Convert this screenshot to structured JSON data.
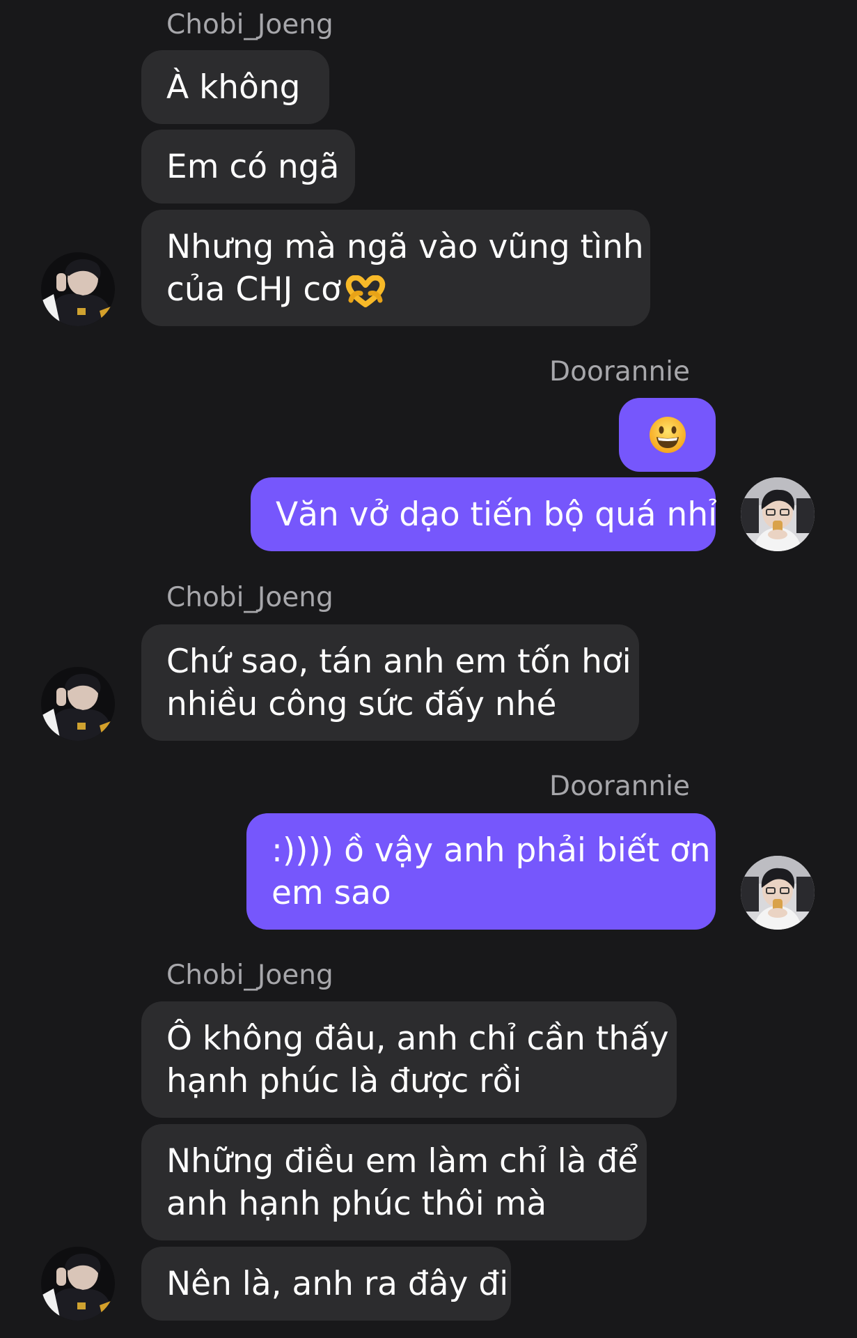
{
  "users": {
    "other": {
      "name": "Chobi_Joeng"
    },
    "me": {
      "name": "Doorannie"
    }
  },
  "colors": {
    "background": "#18181a",
    "incoming_bubble": "#2c2c2e",
    "outgoing_bubble": "#7657fc",
    "sender_name": "#a7a7ab"
  },
  "messages": [
    {
      "sender": "Chobi_Joeng",
      "lines": [
        "À không"
      ]
    },
    {
      "sender": "Chobi_Joeng",
      "lines": [
        "Em có ngã"
      ]
    },
    {
      "sender": "Chobi_Joeng",
      "lines": [
        "Nhưng mà ngã vào vũng tình",
        "của CHJ cơ"
      ],
      "emoji": "heart-hands-icon"
    },
    {
      "sender": "Doorannie",
      "emoji": "grinning-face-icon"
    },
    {
      "sender": "Doorannie",
      "lines": [
        "Văn vở dạo tiến bộ quá nhỉ"
      ]
    },
    {
      "sender": "Chobi_Joeng",
      "lines": [
        "Chứ sao, tán anh em tốn hơi",
        "nhiều công sức đấy nhé"
      ]
    },
    {
      "sender": "Doorannie",
      "lines": [
        ":)))) ồ vậy anh phải biết ơn",
        "em sao"
      ]
    },
    {
      "sender": "Chobi_Joeng",
      "lines": [
        "Ô không đâu, anh chỉ cần thấy",
        "hạnh phúc là được rồi"
      ]
    },
    {
      "sender": "Chobi_Joeng",
      "lines": [
        "Những điều em làm chỉ là để",
        "anh hạnh phúc thôi mà"
      ]
    },
    {
      "sender": "Chobi_Joeng",
      "lines": [
        "Nên là, anh ra đây đi"
      ]
    }
  ]
}
